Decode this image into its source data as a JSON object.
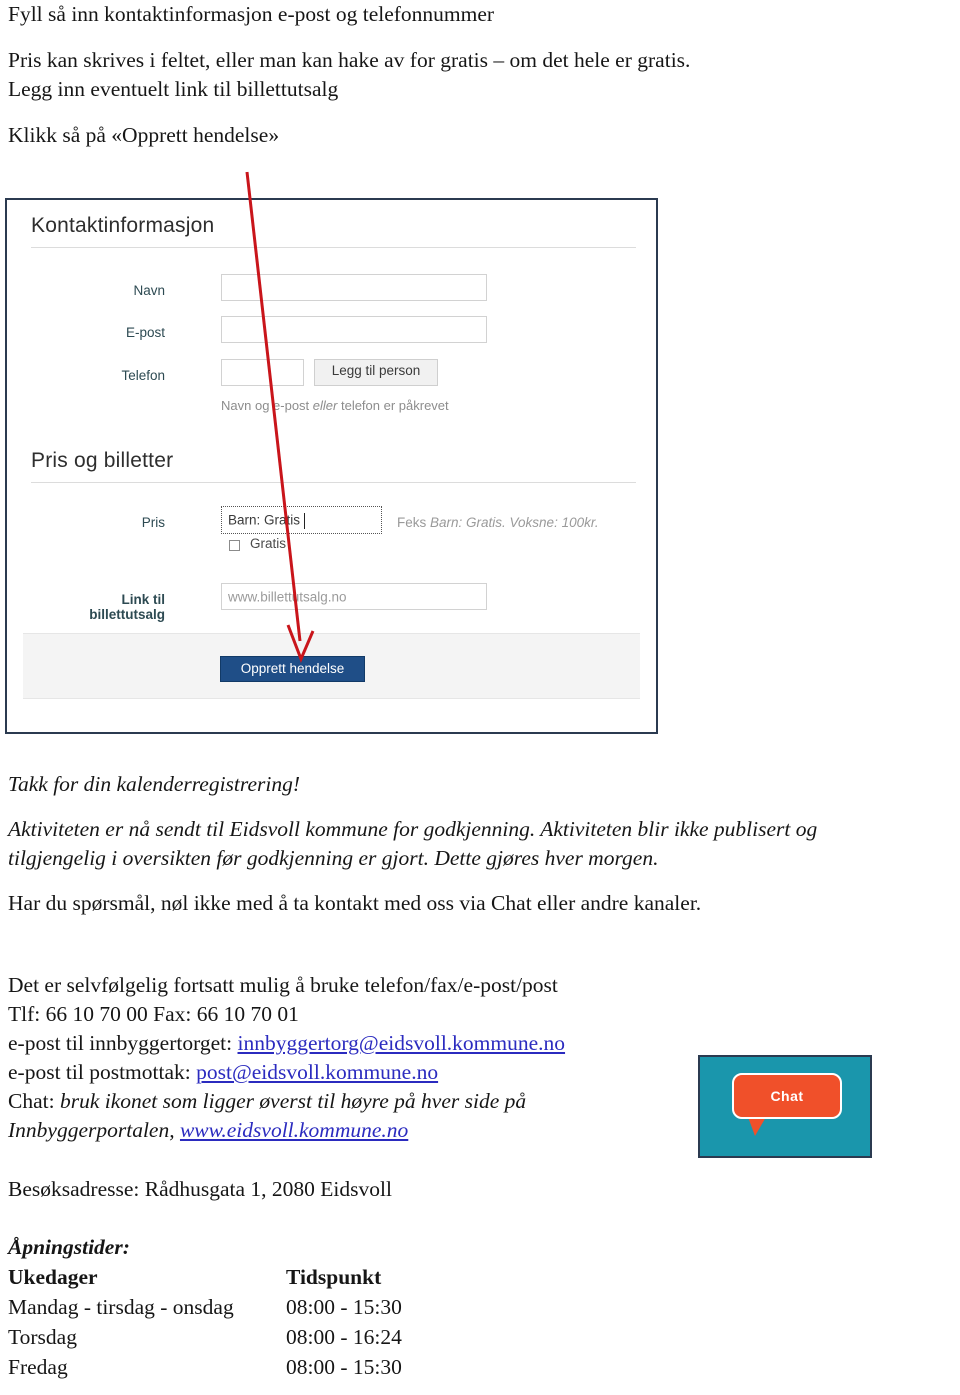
{
  "instructions": {
    "lines": [
      "Fyll så inn kontaktinformasjon e-post og telefonnummer",
      "Pris kan skrives i feltet, eller man kan hake av for gratis – om det hele er gratis.",
      "Legg inn eventuelt link til billettutsalg",
      "Klikk så på «Opprett hendelse»"
    ]
  },
  "form": {
    "contact_section_title": "Kontaktinformasjon",
    "price_section_title": "Pris og billetter",
    "labels": {
      "navn": "Navn",
      "epost": "E-post",
      "telefon": "Telefon",
      "pris": "Pris",
      "link": "Link til billettutsalg"
    },
    "values": {
      "navn": "",
      "epost": "",
      "telefon": "",
      "pris": "Barn: Gratis",
      "link_placeholder": "www.billettutsalg.no"
    },
    "add_person_button": "Legg til person",
    "required_hint_before": "Navn og e-post ",
    "required_hint_italic": "eller",
    "required_hint_after": " telefon er påkrevet",
    "price_example_lead": "Feks ",
    "price_example_italic": "Barn: Gratis. Voksne: 100kr.",
    "free_checkbox_label": "Gratis",
    "free_checkbox_checked": false,
    "submit_button": "Opprett hendelse",
    "colors": {
      "primary_button": "#1f4e87",
      "label_text": "#2d4a52",
      "frame_border": "#2b3a50"
    }
  },
  "annotation": {
    "arrow_color": "#c9151b"
  },
  "body_text": {
    "thanks": "Takk for din kalenderregistrering!",
    "approval_line_1": "Aktiviteten er nå sendt til Eidsvoll kommune for godkjenning. Aktiviteten blir ikke publisert og",
    "approval_line_2": "tilgjengelig i oversikten før godkjenning er gjort. Dette gjøres hver morgen.",
    "questions": "Har du spørsmål, nøl ikke med å ta kontakt med oss via Chat eller andre kanaler.",
    "still_possible": "Det er selvfølgelig fortsatt mulig å bruke telefon/fax/e-post/post",
    "phone_line": "Tlf: 66 10 70 00 Fax: 66 10 70 01",
    "email_innbyggertorget_label": "e-post til innbyggertorget: ",
    "email_innbyggertorget_link": "innbyggertorg@eidsvoll.kommune.no",
    "email_postmottak_label": "e-post til postmottak: ",
    "email_postmottak_link": "post@eidsvoll.kommune.no",
    "chat_label": "Chat: ",
    "chat_italic_1": "bruk ikonet som ligger øverst til høyre på hver side på",
    "chat_italic_2": "Innbyggerportalen, ",
    "chat_link": "www.eidsvoll.kommune.no",
    "visit_address": "Besøksadresse: Rådhusgata 1, 2080 Eidsvoll"
  },
  "chat_widget": {
    "label": "Chat",
    "background_color": "#1a96ac",
    "bubble_color": "#f0502a"
  },
  "opening_hours": {
    "title": "Åpningstider:",
    "header": {
      "day": "Ukedager",
      "time": "Tidspunkt"
    },
    "rows": [
      {
        "day": "Mandag - tirsdag - onsdag",
        "time": "08:00 - 15:30"
      },
      {
        "day": "Torsdag",
        "time": "08:00 - 16:24"
      },
      {
        "day": "Fredag",
        "time": "08:00 - 15:30"
      }
    ]
  }
}
